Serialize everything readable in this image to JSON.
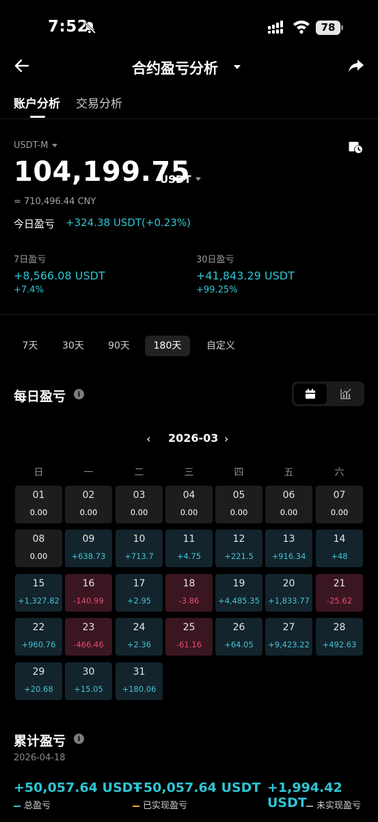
{
  "status": {
    "time": "7:52",
    "battery": "78"
  },
  "header": {
    "title": "合约盈亏分析"
  },
  "tabs": [
    {
      "label": "账户分析"
    },
    {
      "label": "交易分析"
    }
  ],
  "account": {
    "currency": "USDT-M",
    "balance": "104,199.75",
    "unit": "USDT",
    "cny": "≈ 710,496.44 CNY",
    "today_label": "今日盈亏",
    "today_value": "+324.38 USDT(+0.23%)"
  },
  "stats": [
    {
      "label": "7日盈亏",
      "value": "+8,566.08 USDT",
      "pct": "+7.4%"
    },
    {
      "label": "30日盈亏",
      "value": "+41,843.29 USDT",
      "pct": "+99.25%"
    }
  ],
  "ranges": [
    {
      "label": "7天"
    },
    {
      "label": "30天"
    },
    {
      "label": "90天"
    },
    {
      "label": "180天",
      "active": true
    },
    {
      "label": "自定义"
    }
  ],
  "daily": {
    "title": "每日盈亏",
    "month": "2026-03",
    "weekdays": [
      "日",
      "一",
      "二",
      "三",
      "四",
      "五",
      "六"
    ],
    "days": [
      {
        "d": "01",
        "v": "0.00",
        "t": "zero"
      },
      {
        "d": "02",
        "v": "0.00",
        "t": "zero"
      },
      {
        "d": "03",
        "v": "0.00",
        "t": "zero"
      },
      {
        "d": "04",
        "v": "0.00",
        "t": "zero"
      },
      {
        "d": "05",
        "v": "0.00",
        "t": "zero"
      },
      {
        "d": "06",
        "v": "0.00",
        "t": "zero"
      },
      {
        "d": "07",
        "v": "0.00",
        "t": "zero"
      },
      {
        "d": "08",
        "v": "0.00",
        "t": "zero"
      },
      {
        "d": "09",
        "v": "+638.73",
        "t": "pos"
      },
      {
        "d": "10",
        "v": "+713.7",
        "t": "pos"
      },
      {
        "d": "11",
        "v": "+4.75",
        "t": "pos"
      },
      {
        "d": "12",
        "v": "+221.5",
        "t": "pos"
      },
      {
        "d": "13",
        "v": "+916.34",
        "t": "pos"
      },
      {
        "d": "14",
        "v": "+48",
        "t": "pos"
      },
      {
        "d": "15",
        "v": "+1,327.82",
        "t": "pos"
      },
      {
        "d": "16",
        "v": "-140.99",
        "t": "neg"
      },
      {
        "d": "17",
        "v": "+2.95",
        "t": "pos"
      },
      {
        "d": "18",
        "v": "-3.86",
        "t": "neg"
      },
      {
        "d": "19",
        "v": "+4,485.35",
        "t": "pos"
      },
      {
        "d": "20",
        "v": "+1,833.77",
        "t": "pos"
      },
      {
        "d": "21",
        "v": "-25.62",
        "t": "neg"
      },
      {
        "d": "22",
        "v": "+960.76",
        "t": "pos"
      },
      {
        "d": "23",
        "v": "-466.46",
        "t": "neg"
      },
      {
        "d": "24",
        "v": "+2.36",
        "t": "pos"
      },
      {
        "d": "25",
        "v": "-61.16",
        "t": "neg"
      },
      {
        "d": "26",
        "v": "+64.05",
        "t": "pos"
      },
      {
        "d": "27",
        "v": "+9,423.22",
        "t": "pos"
      },
      {
        "d": "28",
        "v": "+492.63",
        "t": "pos"
      },
      {
        "d": "29",
        "v": "+20.68",
        "t": "pos"
      },
      {
        "d": "30",
        "v": "+15.05",
        "t": "pos"
      },
      {
        "d": "31",
        "v": "+180.06",
        "t": "pos"
      }
    ]
  },
  "cumulative": {
    "title": "累计盈亏",
    "date": "2026-04-18",
    "items": [
      {
        "value": "+50,057.64 USDT",
        "label": "总盈亏",
        "color": "#2ec5d4"
      },
      {
        "value": "+50,057.64 USDT",
        "label": "已实现盈亏",
        "color": "#f5a623"
      },
      {
        "value": "+1,994.42 USDT",
        "label": "未实现盈亏",
        "color": "#9b9b9b"
      }
    ]
  },
  "colors": {
    "positive": "#42c4d3",
    "negative": "#ea4a75"
  }
}
